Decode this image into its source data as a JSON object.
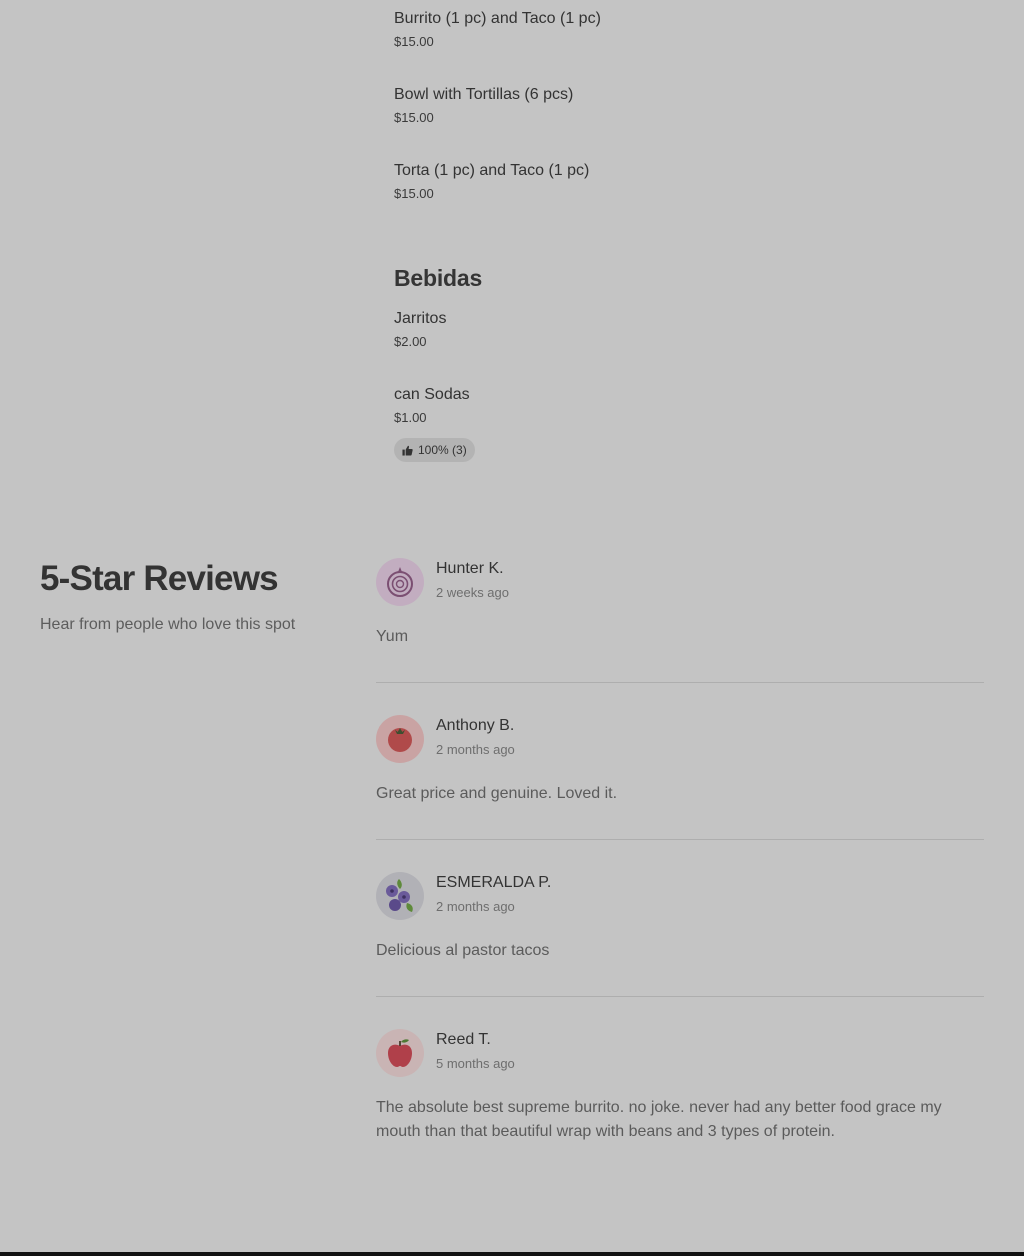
{
  "menu": {
    "items_top": [
      {
        "name": "Burrito (1 pc) and Taco (1 pc)",
        "price": "$15.00"
      },
      {
        "name": "Bowl with Tortillas (6 pcs)",
        "price": "$15.00"
      },
      {
        "name": "Torta (1 pc) and Taco (1 pc)",
        "price": "$15.00"
      }
    ],
    "section_title": "Bebidas",
    "drinks": [
      {
        "name": "Jarritos",
        "price": "$2.00"
      },
      {
        "name": "can Sodas",
        "price": "$1.00",
        "rating": "100% (3)"
      }
    ]
  },
  "reviews": {
    "title": "5-Star Reviews",
    "subtitle": "Hear from people who love this spot",
    "items": [
      {
        "name": "Hunter K.",
        "date": "2 weeks ago",
        "text": "Yum",
        "avatar_icon": "onion-icon",
        "avatar_bg": "#c2adc0"
      },
      {
        "name": "Anthony B.",
        "date": "2 months ago",
        "text": "Great price and genuine. Loved it.",
        "avatar_icon": "tomato-icon",
        "avatar_bg": "#c9a3a3"
      },
      {
        "name": "ESMERALDA P.",
        "date": "2 months ago",
        "text": "Delicious al pastor tacos",
        "avatar_icon": "blueberry-icon",
        "avatar_bg": "#b1b1b6"
      },
      {
        "name": "Reed T.",
        "date": "5 months ago",
        "text": "The absolute best supreme burrito. no joke. never had any better food grace my mouth than that beautiful wrap with beans and 3 types of protein.",
        "avatar_icon": "apple-icon",
        "avatar_bg": "#c9b4b4"
      }
    ]
  }
}
